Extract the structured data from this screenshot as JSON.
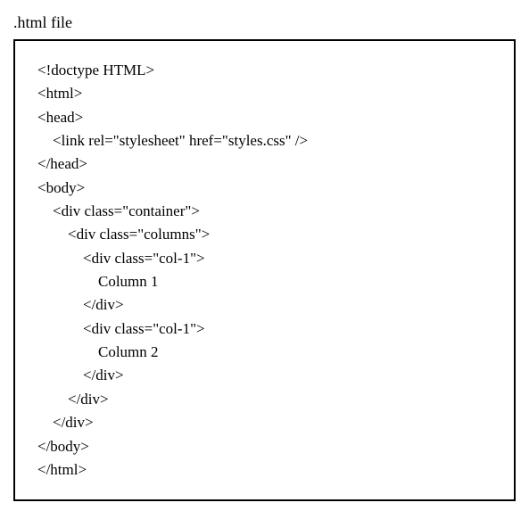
{
  "title": ".html file",
  "code": {
    "lines": [
      "<!doctype HTML>",
      "<html>",
      "<head>",
      "    <link rel=\"stylesheet\" href=\"styles.css\" />",
      "</head>",
      "<body>",
      "    <div class=\"container\">",
      "        <div class=\"columns\">",
      "            <div class=\"col-1\">",
      "                Column 1",
      "            </div>",
      "            <div class=\"col-1\">",
      "                Column 2",
      "            </div>",
      "        </div>",
      "    </div>",
      "</body>",
      "</html>"
    ]
  }
}
